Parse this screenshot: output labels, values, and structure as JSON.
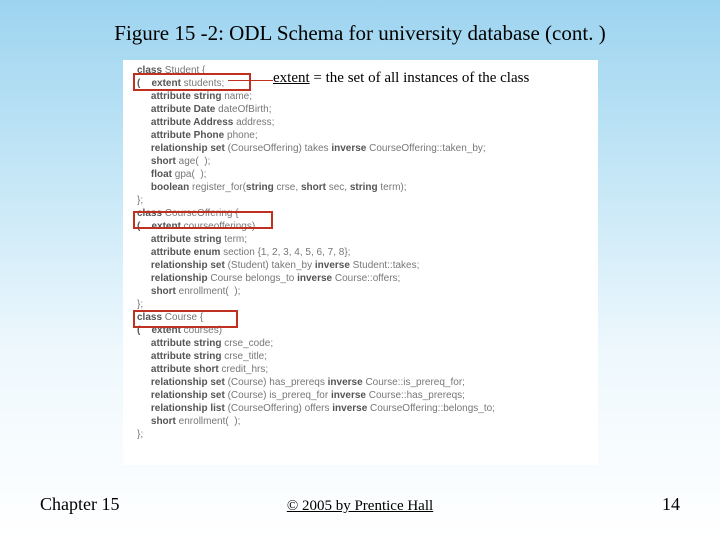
{
  "title": "Figure 15 -2: ODL Schema for university database (cont. )",
  "callout": {
    "extent": "extent",
    "rest": " = the set of all instances of the class"
  },
  "code": {
    "c1": "class",
    "c1a": " Student {",
    "c2": "(    extent",
    "c2a": " students;",
    "c3": "     attribute string",
    "c3a": " name;",
    "c4": "     attribute Date",
    "c4a": " dateOfBirth;",
    "c5": "     attribute Address",
    "c5a": " address;",
    "c6": "     attribute Phone",
    "c6a": " phone;",
    "c7": "     relationship set",
    "c7a": " (CourseOffering) takes ",
    "c7b": "inverse",
    "c7c": " CourseOffering::taken_by;",
    "c8": "     short",
    "c8a": " age(  );",
    "c9": "     float",
    "c9a": " gpa(  );",
    "c10": "     boolean",
    "c10a": " register_for(",
    "c10b": "string",
    "c10c": " crse, ",
    "c10d": "short",
    "c10e": " sec, ",
    "c10f": "string",
    "c10g": " term);",
    "c11": "};",
    "c12": "class",
    "c12a": " CourseOffering {",
    "c13": "(    extent",
    "c13a": " courseofferings)",
    "c14": "     attribute string",
    "c14a": " term;",
    "c15": "     attribute enum",
    "c15a": " section {1, 2, 3, 4, 5, 6, 7, 8};",
    "c16": "     relationship set",
    "c16a": " (Student) taken_by ",
    "c16b": "inverse",
    "c16c": " Student::takes;",
    "c17": "     relationship",
    "c17a": " Course belongs_to ",
    "c17b": "inverse",
    "c17c": " Course::offers;",
    "c18": "     short",
    "c18a": " enrollment(  );",
    "c19": "};",
    "c20": "class",
    "c20a": " Course {",
    "c21": "(    extent",
    "c21a": " courses)",
    "c22": "     attribute string",
    "c22a": " crse_code;",
    "c23": "     attribute string",
    "c23a": " crse_title;",
    "c24": "     attribute short",
    "c24a": " credit_hrs;",
    "c25": "     relationship set",
    "c25a": " (Course) has_prereqs ",
    "c25b": "inverse",
    "c25c": " Course::is_prereq_for;",
    "c26": "     relationship set",
    "c26a": " (Course) is_prereq_for ",
    "c26b": "inverse",
    "c26c": " Course::has_prereqs;",
    "c27": "     relationship list",
    "c27a": " (CourseOffering) offers ",
    "c27b": "inverse",
    "c27c": " CourseOffering::belongs_to;",
    "c28": "     short",
    "c28a": " enrollment(  );",
    "c29": "};"
  },
  "footer": {
    "chapter": "Chapter 15",
    "copyright": "© 2005 by Prentice Hall",
    "page": "14"
  }
}
